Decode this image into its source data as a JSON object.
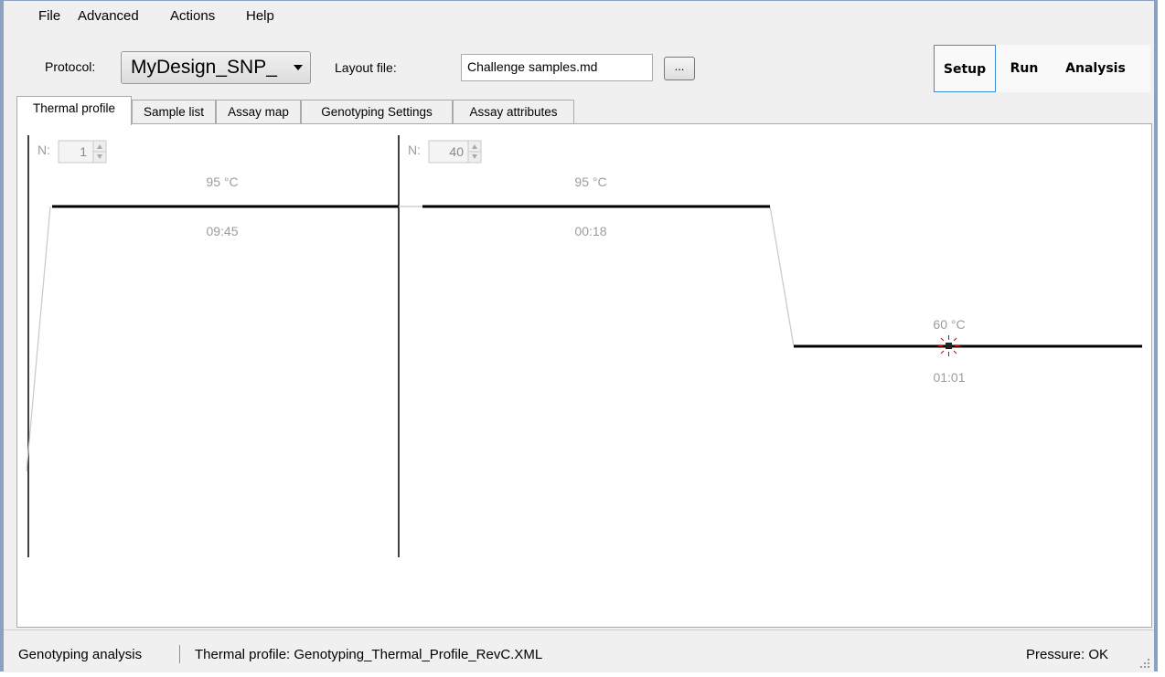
{
  "menu": {
    "file": "File",
    "advanced": "Advanced",
    "actions": "Actions",
    "help": "Help"
  },
  "toolbar": {
    "protocol_label": "Protocol:",
    "protocol_value": "MyDesign_SNP_",
    "layout_label": "Layout file:",
    "layout_value": "Challenge samples.md",
    "browse_label": "..."
  },
  "modes": {
    "setup": "Setup",
    "run": "Run",
    "analysis": "Analysis",
    "active": "Setup"
  },
  "tabs": [
    {
      "label": "Thermal profile"
    },
    {
      "label": "Sample list"
    },
    {
      "label": "Assay map"
    },
    {
      "label": "Genotyping Settings"
    },
    {
      "label": "Assay attributes"
    }
  ],
  "thermal_profile": {
    "stages": [
      {
        "n_label": "N:",
        "cycles": "1",
        "steps": [
          {
            "temperature": "95 °C",
            "time": "09:45"
          }
        ]
      },
      {
        "n_label": "N:",
        "cycles": "40",
        "steps": [
          {
            "temperature": "95 °C",
            "time": "00:18"
          },
          {
            "temperature": "60 °C",
            "time": "01:01"
          }
        ]
      }
    ]
  },
  "status": {
    "mode": "Genotyping analysis",
    "profile": "Thermal profile: Genotyping_Thermal_Profile_RevC.XML",
    "pressure": "Pressure: OK"
  },
  "colors": {
    "accent": "#3c8bd9",
    "profile_line": "#000000",
    "ramp_line": "#c8c8c8",
    "disabled_text": "#9c9c9c",
    "marker": "#cc0000"
  }
}
